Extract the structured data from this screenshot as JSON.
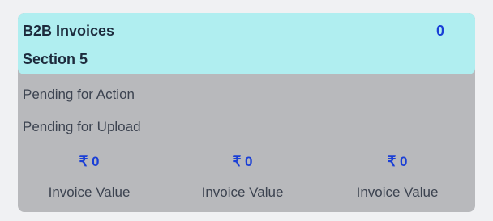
{
  "tile": {
    "title": "B2B Invoices",
    "count": "0",
    "section": "Section 5",
    "statuses": [
      "Pending for Action",
      "Pending for Upload"
    ],
    "values": [
      {
        "amount": "₹ 0",
        "label": "Invoice Value"
      },
      {
        "amount": "₹ 0",
        "label": "Invoice Value"
      },
      {
        "amount": "₹ 0",
        "label": "Invoice Value"
      }
    ],
    "colors": {
      "header_bg": "#b0eef0",
      "body_bg": "#b8b9bc",
      "accent": "#1a3fd6"
    }
  }
}
